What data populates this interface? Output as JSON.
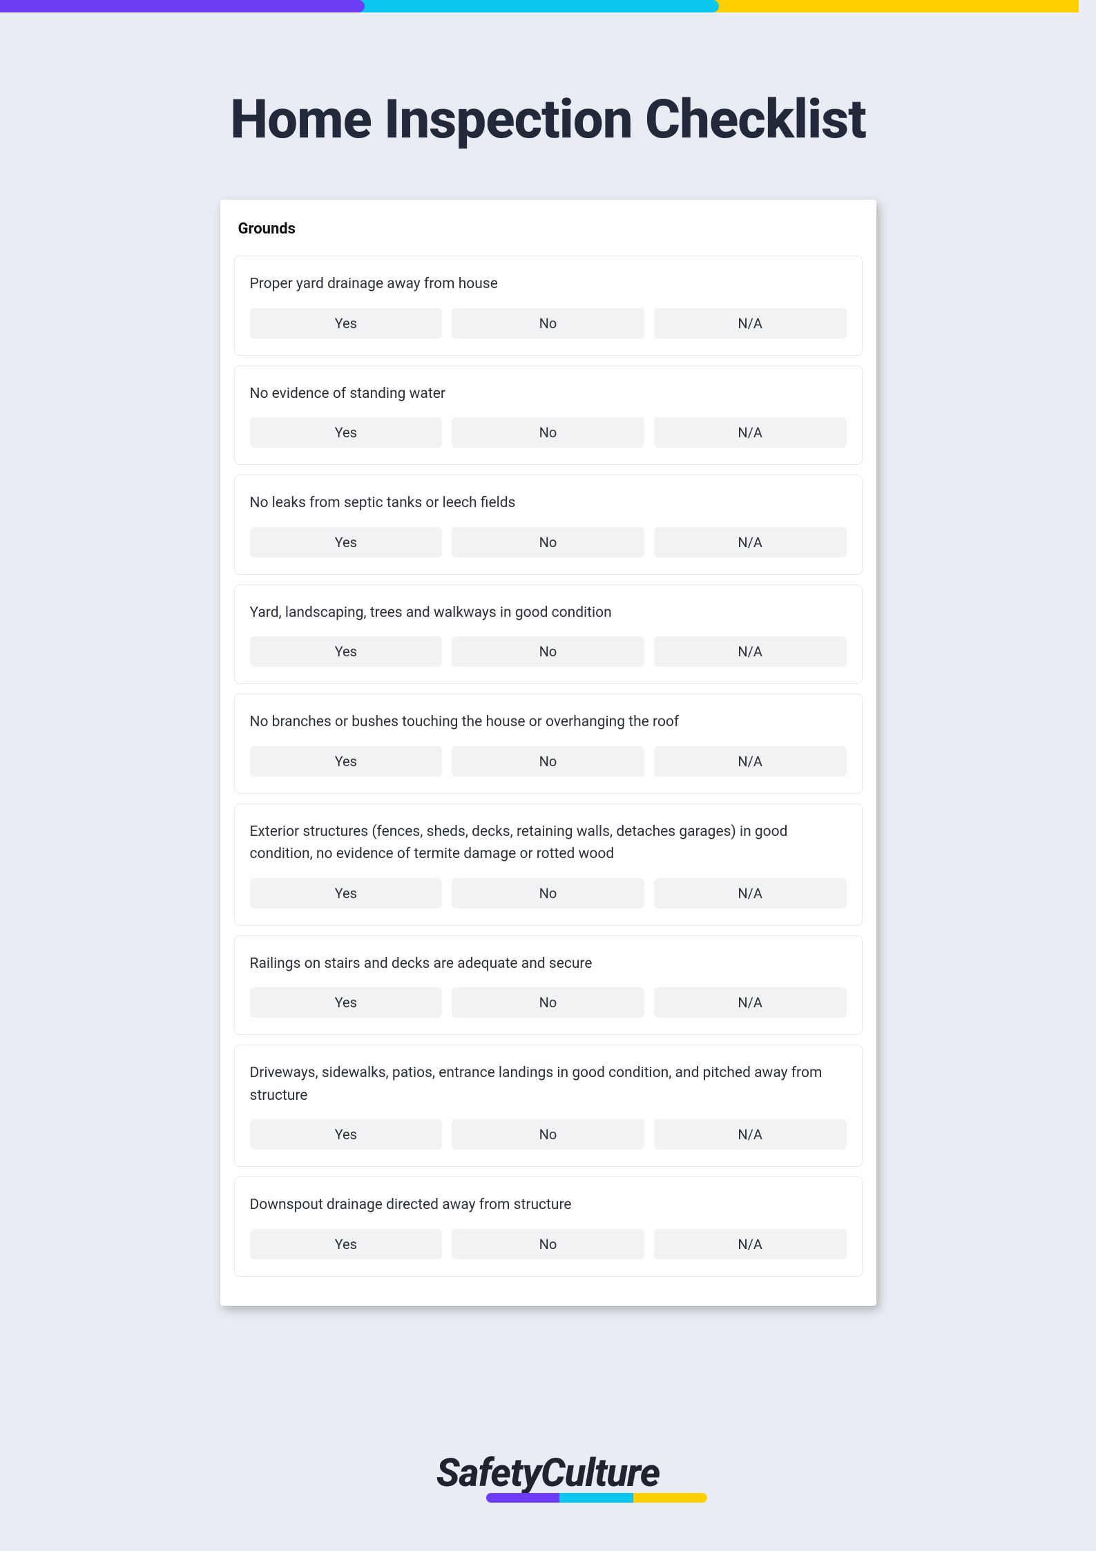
{
  "title": "Home Inspection Checklist",
  "section": "Grounds",
  "options": {
    "yes": "Yes",
    "no": "No",
    "na": "N/A"
  },
  "questions": [
    {
      "text": "Proper yard drainage away from house"
    },
    {
      "text": "No evidence of standing water"
    },
    {
      "text": "No leaks from septic tanks or leech fields"
    },
    {
      "text": "Yard, landscaping, trees and walkways in good condition"
    },
    {
      "text": "No branches or bushes touching the house or overhanging the roof"
    },
    {
      "text": "Exterior structures (fences, sheds, decks, retaining walls, detaches garages) in good condition, no evidence of termite damage or rotted wood"
    },
    {
      "text": "Railings on stairs and decks are adequate and secure"
    },
    {
      "text": "Driveways, sidewalks, patios, entrance landings in good condition, and pitched away from structure"
    },
    {
      "text": "Downspout drainage directed away from structure"
    }
  ],
  "logo": "SafetyCulture"
}
